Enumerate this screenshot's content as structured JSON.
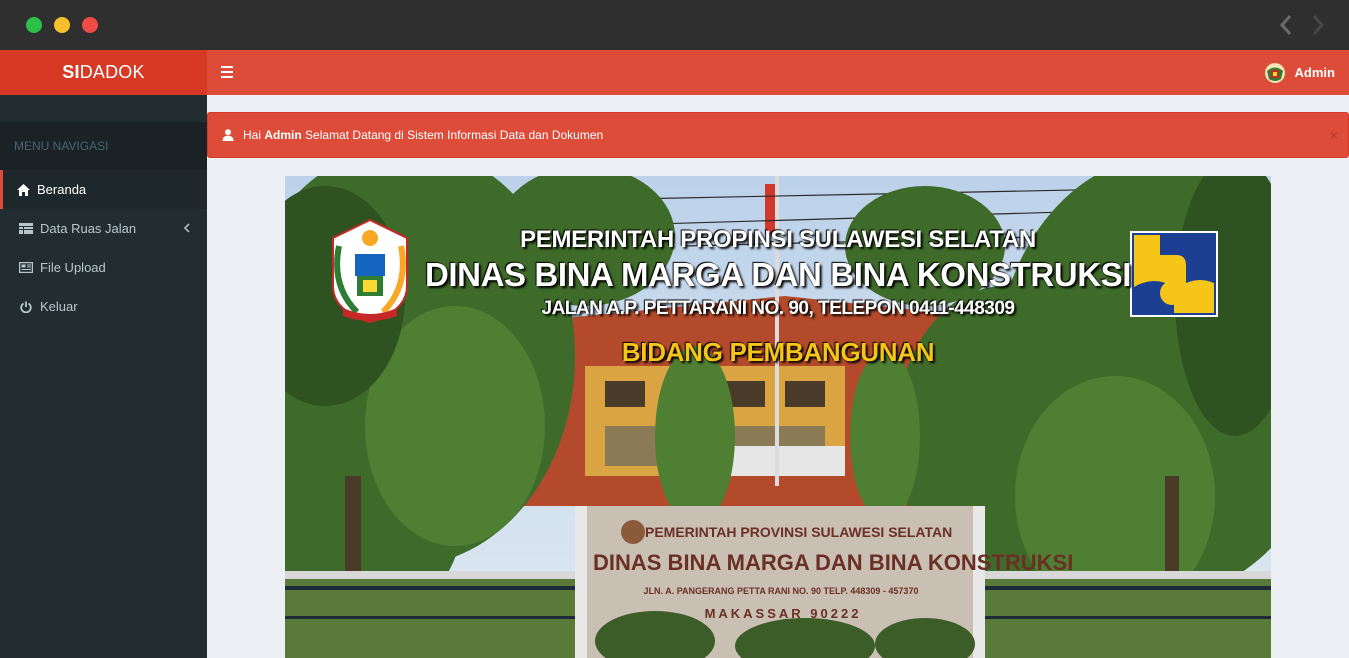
{
  "app": {
    "logo_bold": "SI",
    "logo_rest": "DADOK",
    "user_name": "Admin"
  },
  "sidebar": {
    "header": "MENU NAVIGASI",
    "items": [
      {
        "label": "Beranda",
        "icon": "home-icon",
        "active": true
      },
      {
        "label": "Data Ruas Jalan",
        "icon": "table-icon",
        "has_submenu": true
      },
      {
        "label": "File Upload",
        "icon": "newspaper-icon"
      },
      {
        "label": "Keluar",
        "icon": "power-icon"
      }
    ]
  },
  "alert": {
    "prefix": "Hai",
    "name": "Admin",
    "message": "Selamat Datang di Sistem Informasi Data dan Dokumen",
    "close": "×"
  },
  "banner": {
    "line1": "PEMERINTAH PROPINSI SULAWESI SELATAN",
    "line2": "DINAS BINA MARGA DAN BINA KONSTRUKSI",
    "line3": "JALAN A.P. PETTARANI NO. 90, TELEPON  0411-448309",
    "line4": "BIDANG PEMBANGUNAN",
    "sign_line1": "PEMERINTAH PROVINSI SULAWESI SELATAN",
    "sign_line2": "DINAS BINA MARGA DAN BINA KONSTRUKSI",
    "sign_line3": "JLN. A. PANGERANG PETTA RANI NO. 90 TELP. 448309 - 457370",
    "sign_line4": "MAKASSAR 90222"
  },
  "colors": {
    "header_red": "#dd4b39",
    "logo_red": "#d73925",
    "sidebar_dark": "#222d32",
    "accent_yellow": "#f5c518"
  }
}
